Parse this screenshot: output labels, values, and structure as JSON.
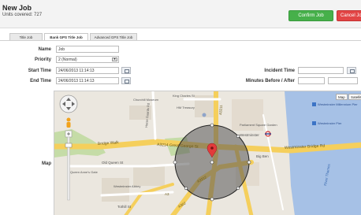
{
  "header": {
    "title": "New Job",
    "subtitle": "Units covered: 727",
    "confirm_label": "Confirm Job",
    "cancel_label": "Cancel Job"
  },
  "tabs": [
    {
      "label": "Title Job",
      "active": false
    },
    {
      "label": "Bank GPS Title Job",
      "active": true
    },
    {
      "label": "Advanced GPS Title Job",
      "active": false
    }
  ],
  "form": {
    "name_label": "Name",
    "name_value": "Job",
    "priority_label": "Priority",
    "priority_value": "2 (Normal)",
    "start_label": "Start Time",
    "start_value": "24/06/2013 11:14:13",
    "end_label": "End Time",
    "end_value": "24/06/2013 11:14:13",
    "incident_label": "Incident Time",
    "incident_value": "",
    "minutes_label": "Minutes Before / After",
    "minutes_before_value": "",
    "minutes_after_value": "",
    "map_label": "Map"
  },
  "map": {
    "type_map": "Map",
    "type_satellite": "Satellite",
    "labels": {
      "bridge_walk": "Bridge Walk",
      "great_george": "A3214 Great George St",
      "westminster_bridge": "Westminster Bridge Rd",
      "old_queen": "Old Queen St",
      "a3212": "A3212",
      "a302": "A302",
      "big_ben": "Big Ben",
      "westminster": "Westminster",
      "parliament": "Parliament Square Garden",
      "abbey": "Westminster Abbey",
      "tothill": "Tothill St",
      "churchill": "Churchill Museum",
      "horse_guards": "Horse Guards Rd",
      "hm_treasury": "HM Treasury",
      "king_charles": "King Charles St",
      "whitehall": "A3211",
      "millennium_pier": "Westminster Millennium Pier",
      "westminster_pier": "Westminster Pier",
      "queen_anne": "Queen Anne's Gate",
      "thames": "River Thames",
      "a3": "A3"
    },
    "colors": {
      "park": "#c5dca7",
      "water": "#a6c1e6",
      "road_major": "#f5cf5c",
      "road_minor": "#ffffff",
      "radius_fill": "#555555"
    }
  }
}
